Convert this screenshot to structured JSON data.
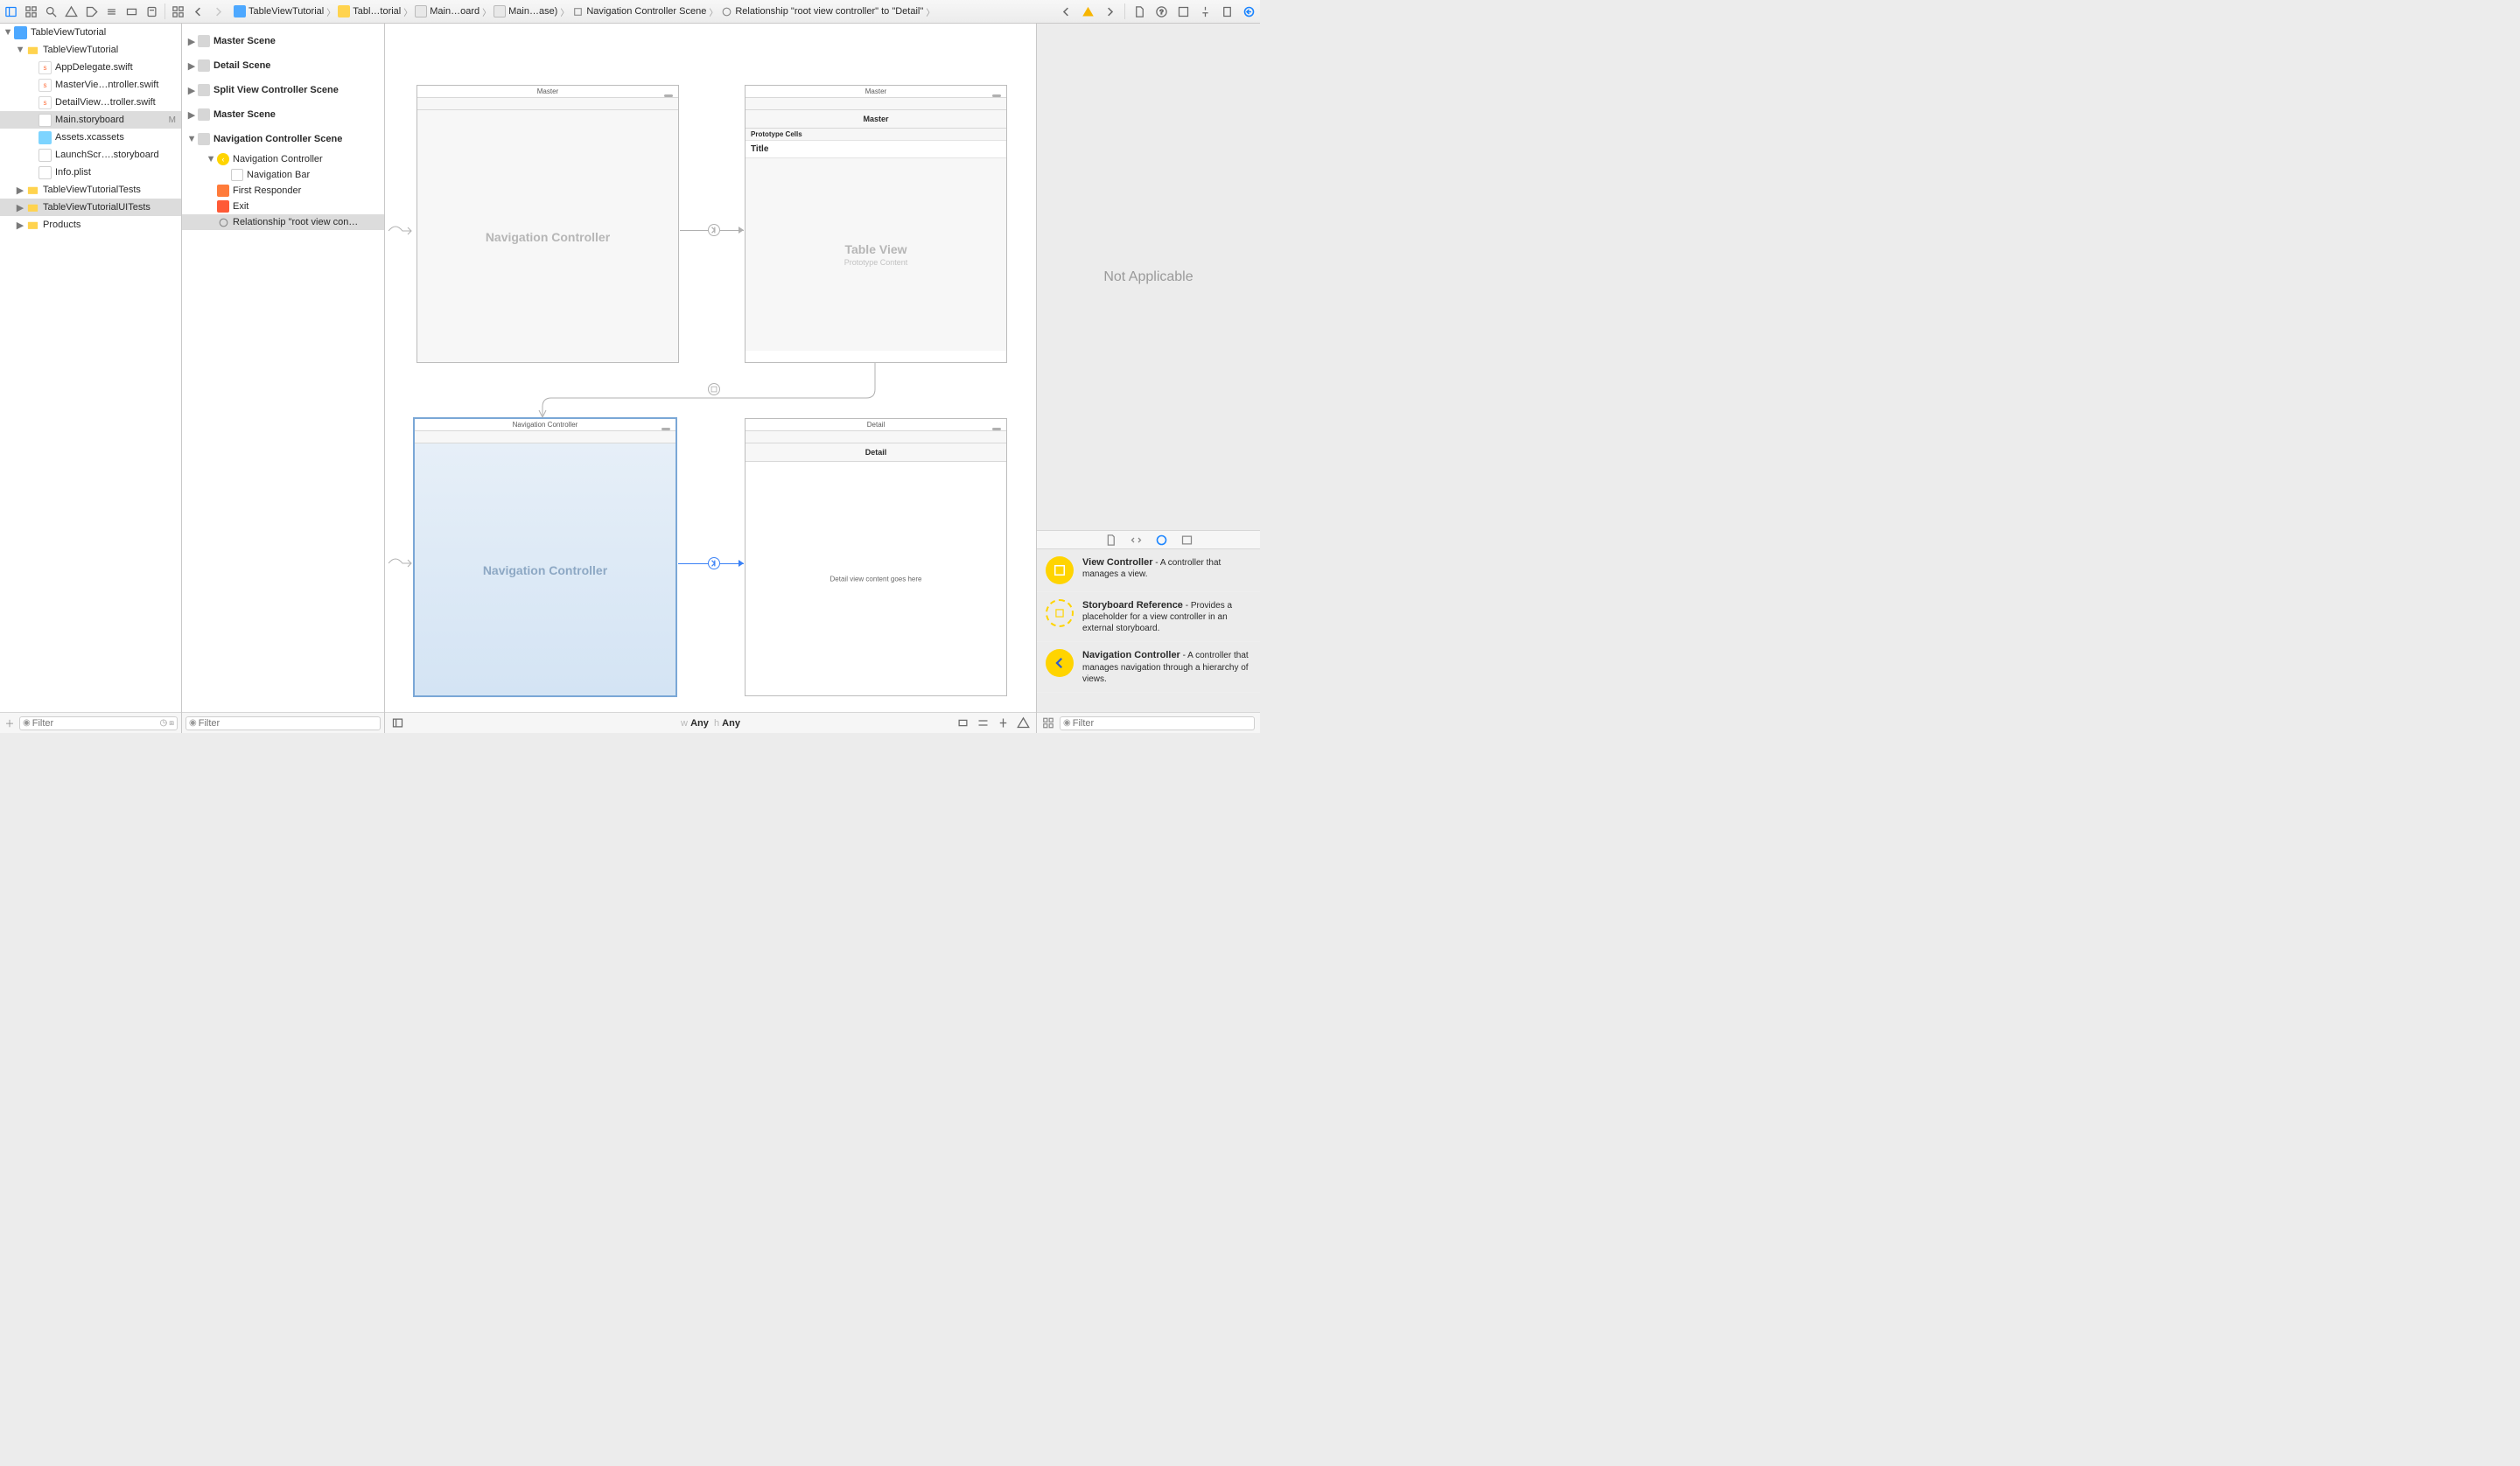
{
  "toolbar": {
    "crumbs": [
      {
        "icon": "app",
        "text": "TableViewTutorial"
      },
      {
        "icon": "folder",
        "text": "Tabl…torial"
      },
      {
        "icon": "storyboard",
        "text": "Main…oard"
      },
      {
        "icon": "storyboard",
        "text": "Main…ase)"
      },
      {
        "icon": "scene",
        "text": "Navigation Controller Scene"
      },
      {
        "icon": "segue",
        "text": "Relationship \"root view controller\" to \"Detail\""
      }
    ]
  },
  "navigator": {
    "root": {
      "label": "TableViewTutorial"
    },
    "group": {
      "label": "TableViewTutorial"
    },
    "files": [
      {
        "label": "AppDelegate.swift",
        "kind": "swift"
      },
      {
        "label": "MasterVie…ntroller.swift",
        "kind": "swift"
      },
      {
        "label": "DetailView…troller.swift",
        "kind": "swift"
      },
      {
        "label": "Main.storyboard",
        "kind": "storyboard",
        "badge": "M",
        "selected": true
      },
      {
        "label": "Assets.xcassets",
        "kind": "assets"
      },
      {
        "label": "LaunchScr….storyboard",
        "kind": "storyboard"
      },
      {
        "label": "Info.plist",
        "kind": "plist"
      }
    ],
    "groups2": [
      {
        "label": "TableViewTutorialTests"
      },
      {
        "label": "TableViewTutorialUITests",
        "selected": true
      },
      {
        "label": "Products"
      }
    ],
    "filter_placeholder": "Filter"
  },
  "outline": {
    "scenes": [
      {
        "label": "Master Scene",
        "expanded": false
      },
      {
        "label": "Detail Scene",
        "expanded": false
      },
      {
        "label": "Split View Controller Scene",
        "expanded": false
      },
      {
        "label": "Master Scene",
        "expanded": false
      },
      {
        "label": "Navigation Controller Scene",
        "expanded": true,
        "children": [
          {
            "label": "Navigation Controller",
            "icon": "navctl",
            "expanded": true,
            "children": [
              {
                "label": "Navigation Bar",
                "icon": "navbar"
              }
            ]
          },
          {
            "label": "First Responder",
            "icon": "first"
          },
          {
            "label": "Exit",
            "icon": "exit"
          },
          {
            "label": "Relationship \"root view con…",
            "icon": "segue",
            "selected": true
          }
        ]
      }
    ],
    "filter_placeholder": "Filter"
  },
  "canvas": {
    "scenes": {
      "master_nav": {
        "title": "Master",
        "big": "Navigation Controller"
      },
      "master_table": {
        "title": "Master",
        "navlabel": "Master",
        "proto_hdr": "Prototype Cells",
        "proto_cell": "Title",
        "big": "Table View",
        "sub": "Prototype Content"
      },
      "detail_nav": {
        "title": "Navigation Controller",
        "big": "Navigation Controller"
      },
      "detail": {
        "title": "Detail",
        "navlabel": "Detail",
        "body": "Detail view content goes here"
      }
    },
    "size_class": {
      "w_prefix": "w",
      "w": "Any",
      "h_prefix": "h",
      "h": "Any"
    }
  },
  "inspector": {
    "na": "Not Applicable",
    "filter_placeholder": "Filter",
    "library": [
      {
        "title": "View Controller",
        "desc": " - A controller that manages a view.",
        "kind": "vc"
      },
      {
        "title": "Storyboard Reference",
        "desc": " - Provides a placeholder for a view controller in an external storyboard.",
        "kind": "sref"
      },
      {
        "title": "Navigation Controller",
        "desc": " - A controller that manages navigation through a hierarchy of views.",
        "kind": "nav"
      }
    ]
  }
}
